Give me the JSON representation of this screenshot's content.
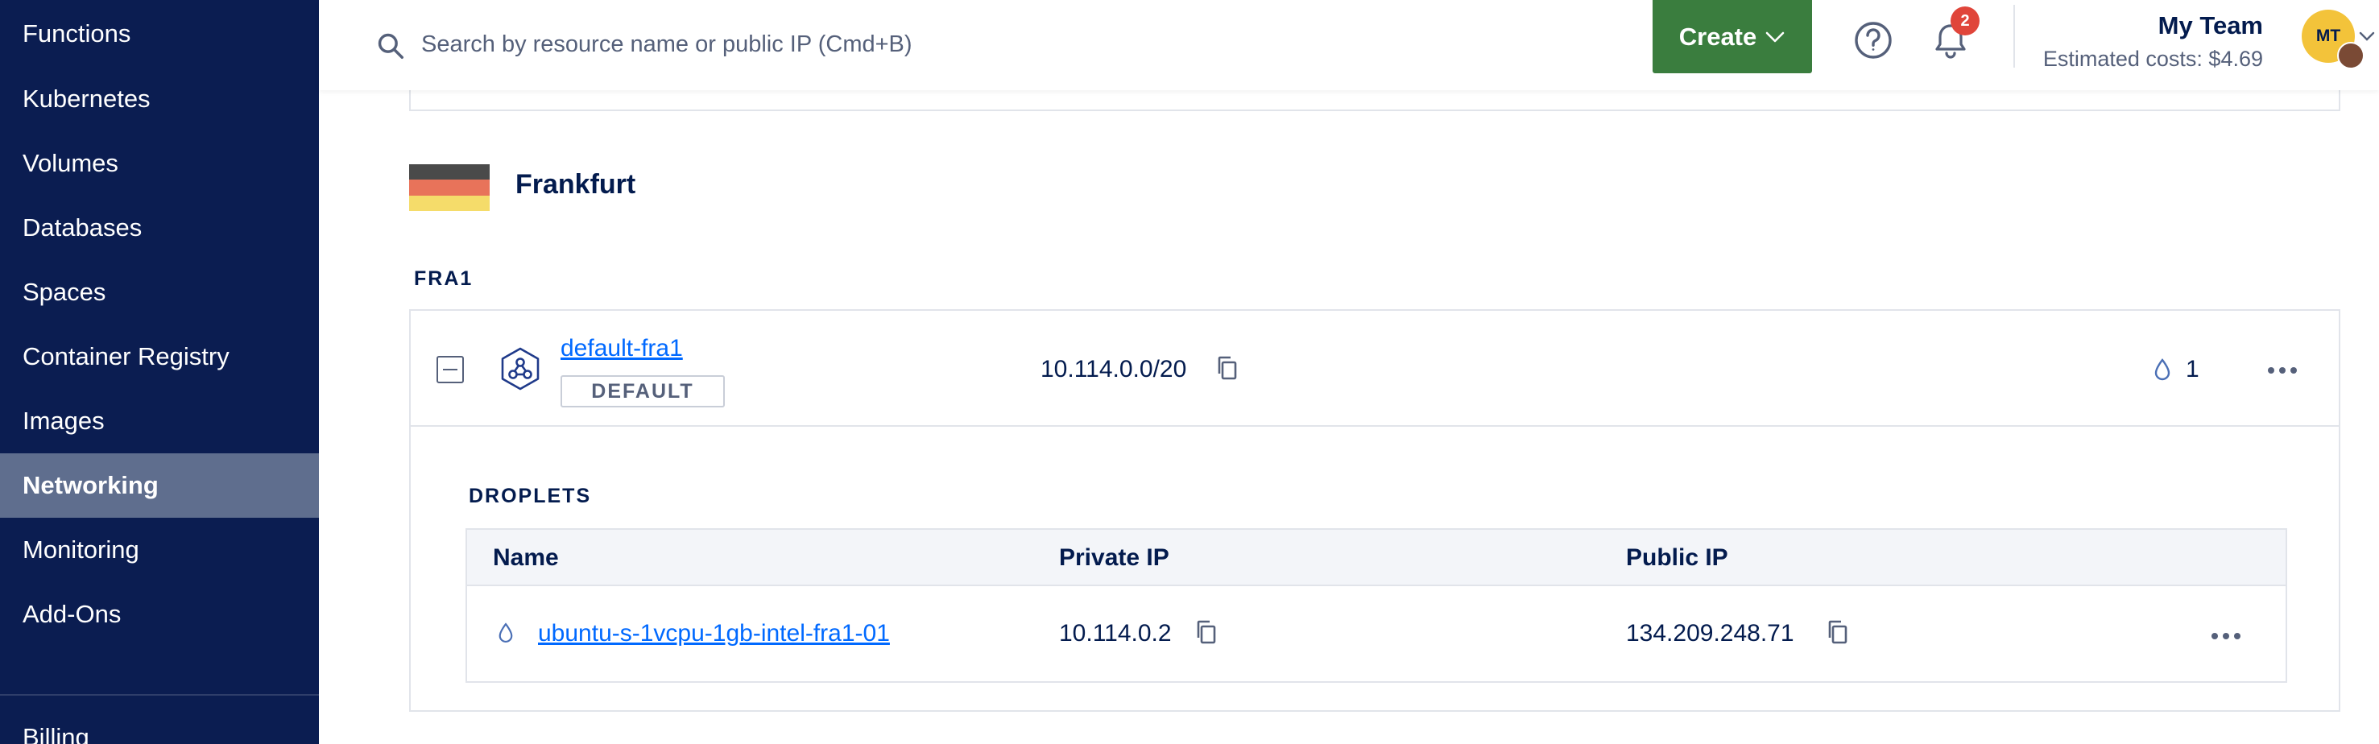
{
  "sidebar": {
    "items": [
      {
        "label": "Functions"
      },
      {
        "label": "Kubernetes"
      },
      {
        "label": "Volumes"
      },
      {
        "label": "Databases"
      },
      {
        "label": "Spaces"
      },
      {
        "label": "Container Registry"
      },
      {
        "label": "Images"
      },
      {
        "label": "Networking",
        "active": true
      },
      {
        "label": "Monitoring"
      },
      {
        "label": "Add-Ons"
      },
      {
        "label": "Billing"
      }
    ]
  },
  "topbar": {
    "search_placeholder": "Search by resource name or public IP (Cmd+B)",
    "create_label": "Create",
    "notification_count": "2",
    "team_name": "My Team",
    "estimated_costs": "Estimated costs: $4.69",
    "avatar_initials": "MT"
  },
  "region": {
    "name": "Frankfurt",
    "code": "FRA1",
    "flag_colors": [
      "#4a4a4a",
      "#e8735a",
      "#f5dc6a"
    ],
    "vpc": {
      "name": "default-fra1",
      "badge": "DEFAULT",
      "ip_range": "10.114.0.0/20",
      "resource_count": "1",
      "droplets": {
        "title": "DROPLETS",
        "columns": [
          "Name",
          "Private IP",
          "Public IP"
        ],
        "rows": [
          {
            "name": "ubuntu-s-1vcpu-1gb-intel-fra1-01",
            "private_ip": "10.114.0.2",
            "public_ip": "134.209.248.71"
          }
        ]
      }
    }
  },
  "colors": {
    "sidebar_bg": "#0b1d51",
    "sidebar_active": "#5f6e8e",
    "create_button": "#3a7d3e",
    "link": "#0069ff",
    "badge": "#e0453a"
  }
}
